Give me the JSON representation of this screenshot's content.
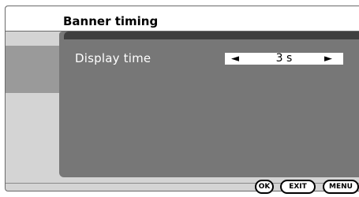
{
  "title": "Banner timing",
  "setting": {
    "label": "Display time",
    "value": "3 s",
    "left_arrow": "◄",
    "right_arrow": "►"
  },
  "buttons": {
    "ok": "OK",
    "exit": "EXIT",
    "menu": "MENU"
  },
  "colors": {
    "panel": "#777777",
    "panel_topbar": "#3f3f3f",
    "frame_bg": "#d4d4d4",
    "side_strip": "#9a9a9a"
  }
}
